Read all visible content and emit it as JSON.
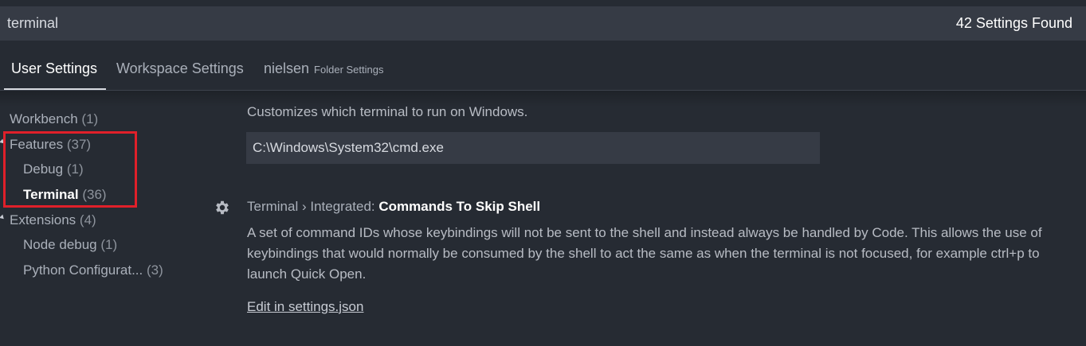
{
  "search": {
    "value": "terminal",
    "result_count": "42 Settings Found"
  },
  "tabs": [
    {
      "label": "User Settings"
    },
    {
      "label": "Workspace Settings"
    },
    {
      "label": "nielsen",
      "sublabel": "Folder Settings"
    }
  ],
  "sidebar": {
    "items": [
      {
        "label": "Workbench",
        "count": "(1)"
      },
      {
        "label": "Features",
        "count": "(37)"
      },
      {
        "label": "Debug",
        "count": "(1)"
      },
      {
        "label": "Terminal",
        "count": "(36)"
      },
      {
        "label": "Extensions",
        "count": "(4)"
      },
      {
        "label": "Node debug",
        "count": "(1)"
      },
      {
        "label": "Python Configurat...",
        "count": "(3)"
      }
    ]
  },
  "main": {
    "previous_description": "Customizes which terminal to run on Windows.",
    "path_value": "C:\\Windows\\System32\\cmd.exe",
    "setting": {
      "category": "Terminal › Integrated: ",
      "name": "Commands To Skip Shell",
      "description": "A set of command IDs whose keybindings will not be sent to the shell and instead always be handled by Code. This allows the use of keybindings that would normally be consumed by the shell to act the same as when the terminal is not focused, for example ctrl+p to launch Quick Open.",
      "edit_link": "Edit in settings.json",
      "icon": "gear-icon"
    }
  },
  "colors": {
    "background": "#262b33",
    "input_background": "#363b45",
    "highlight_box": "#e0202a"
  }
}
